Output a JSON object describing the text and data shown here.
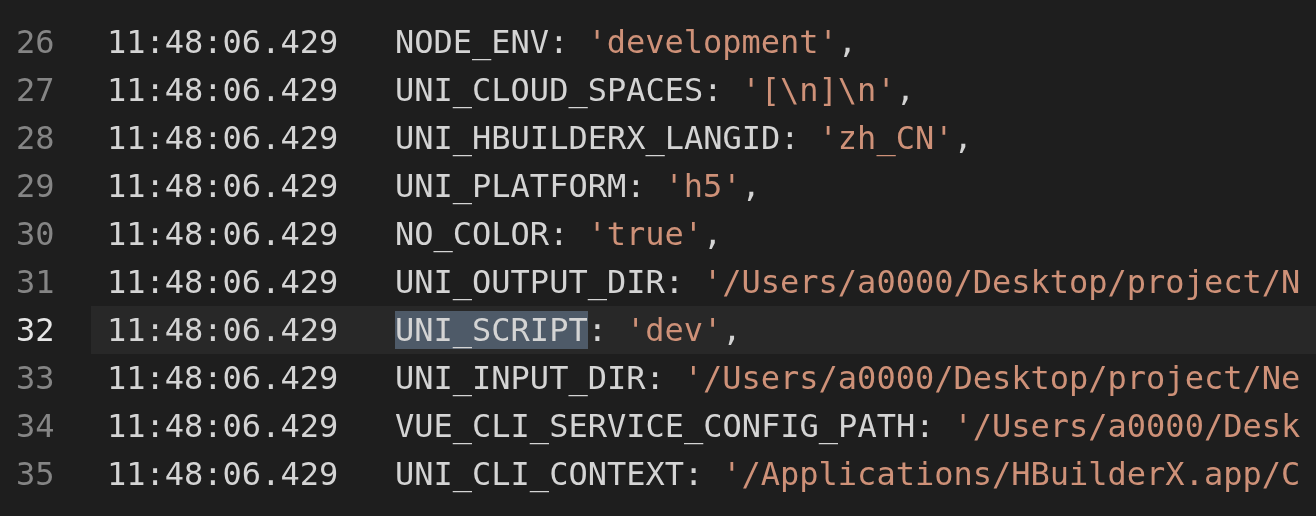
{
  "lines": [
    {
      "number": "26",
      "time": "11:48:06.429",
      "key": "NODE_ENV",
      "sep": ":",
      "value": "'development'",
      "end": ",",
      "current": false,
      "selected": false
    },
    {
      "number": "27",
      "time": "11:48:06.429",
      "key": "UNI_CLOUD_SPACES",
      "sep": ":",
      "value": "'[\\n]\\n'",
      "end": ",",
      "current": false,
      "selected": false
    },
    {
      "number": "28",
      "time": "11:48:06.429",
      "key": "UNI_HBUILDERX_LANGID",
      "sep": ":",
      "value": "'zh_CN'",
      "end": ",",
      "current": false,
      "selected": false
    },
    {
      "number": "29",
      "time": "11:48:06.429",
      "key": "UNI_PLATFORM",
      "sep": ":",
      "value": "'h5'",
      "end": ",",
      "current": false,
      "selected": false
    },
    {
      "number": "30",
      "time": "11:48:06.429",
      "key": "NO_COLOR",
      "sep": ":",
      "value": "'true'",
      "end": ",",
      "current": false,
      "selected": false
    },
    {
      "number": "31",
      "time": "11:48:06.429",
      "key": "UNI_OUTPUT_DIR",
      "sep": ":",
      "value": "'/Users/a0000/Desktop/project/N",
      "current": false,
      "selected": false
    },
    {
      "number": "32",
      "time": "11:48:06.429",
      "key": "UNI_SCRIPT",
      "sep": ":",
      "value": "'dev'",
      "end": ",",
      "current": true,
      "selected": true
    },
    {
      "number": "33",
      "time": "11:48:06.429",
      "key": "UNI_INPUT_DIR",
      "sep": ":",
      "value": "'/Users/a0000/Desktop/project/Ne",
      "current": false,
      "selected": false
    },
    {
      "number": "34",
      "time": "11:48:06.429",
      "key": "VUE_CLI_SERVICE_CONFIG_PATH",
      "sep": ":",
      "value": "'/Users/a0000/Desk",
      "current": false,
      "selected": false
    },
    {
      "number": "35",
      "time": "11:48:06.429",
      "key": "UNI_CLI_CONTEXT",
      "sep": ":",
      "value": "'/Applications/HBuilderX.app/C",
      "current": false,
      "selected": false
    }
  ]
}
